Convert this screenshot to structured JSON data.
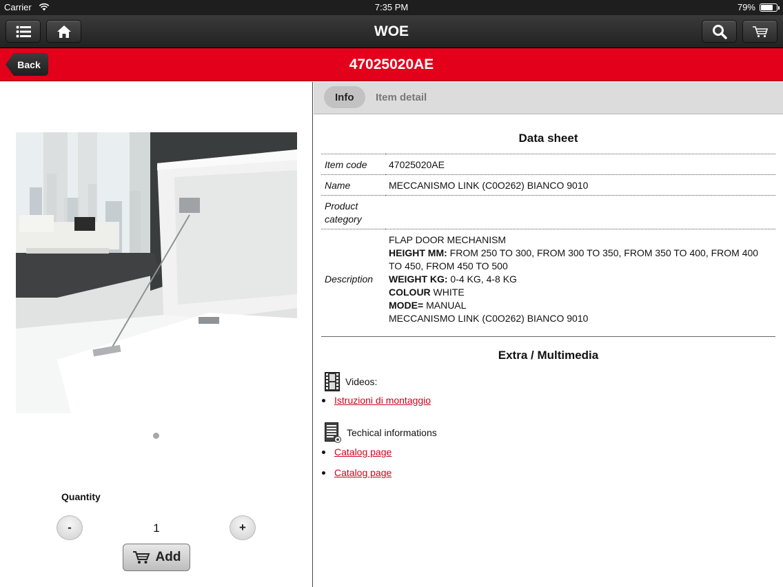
{
  "status_bar": {
    "carrier": "Carrier",
    "time": "7:35 PM",
    "battery": "79%",
    "battery_level": 0.79
  },
  "navbar": {
    "title": "WOE"
  },
  "header": {
    "back_label": "Back",
    "title": "47025020AE"
  },
  "left_panel": {
    "quantity_label": "Quantity",
    "decrement_label": "-",
    "increment_label": "+",
    "quantity_value": "1",
    "add_label": "Add"
  },
  "tabs": [
    {
      "label": "Info",
      "active": true
    },
    {
      "label": "Item detail",
      "active": false
    }
  ],
  "datasheet": {
    "title": "Data sheet",
    "item_code_label": "Item code",
    "item_code_value": "47025020AE",
    "name_label": "Name",
    "name_value": "MECCANISMO LINK (C0O262) BIANCO 9010",
    "category_label": "Product category",
    "category_value": "",
    "description_label": "Description",
    "description_line1": "FLAP DOOR MECHANISM",
    "height_key": "HEIGHT MM:",
    "height_value": " FROM 250 TO 300, FROM 300 TO 350, FROM 350 TO 400, FROM 400 TO 450, FROM 450 TO 500",
    "weight_key": "WEIGHT KG:",
    "weight_value": " 0-4 KG, 4-8 KG",
    "colour_key": "COLOUR",
    "colour_value": " WHITE",
    "mode_key": "MODE=",
    "mode_value": " MANUAL",
    "description_last": "MECCANISMO LINK (C0O262) BIANCO 9010"
  },
  "multimedia": {
    "title": "Extra / Multimedia",
    "videos_label": "Videos:",
    "video_links": [
      "Istruzioni di montaggio"
    ],
    "tech_label": "Techical informations",
    "tech_links": [
      "Catalog page",
      "Catalog page"
    ]
  },
  "colors": {
    "brand_red": "#e3001b",
    "link_red": "#d0021b",
    "nav_dark": "#2b2b2b"
  }
}
